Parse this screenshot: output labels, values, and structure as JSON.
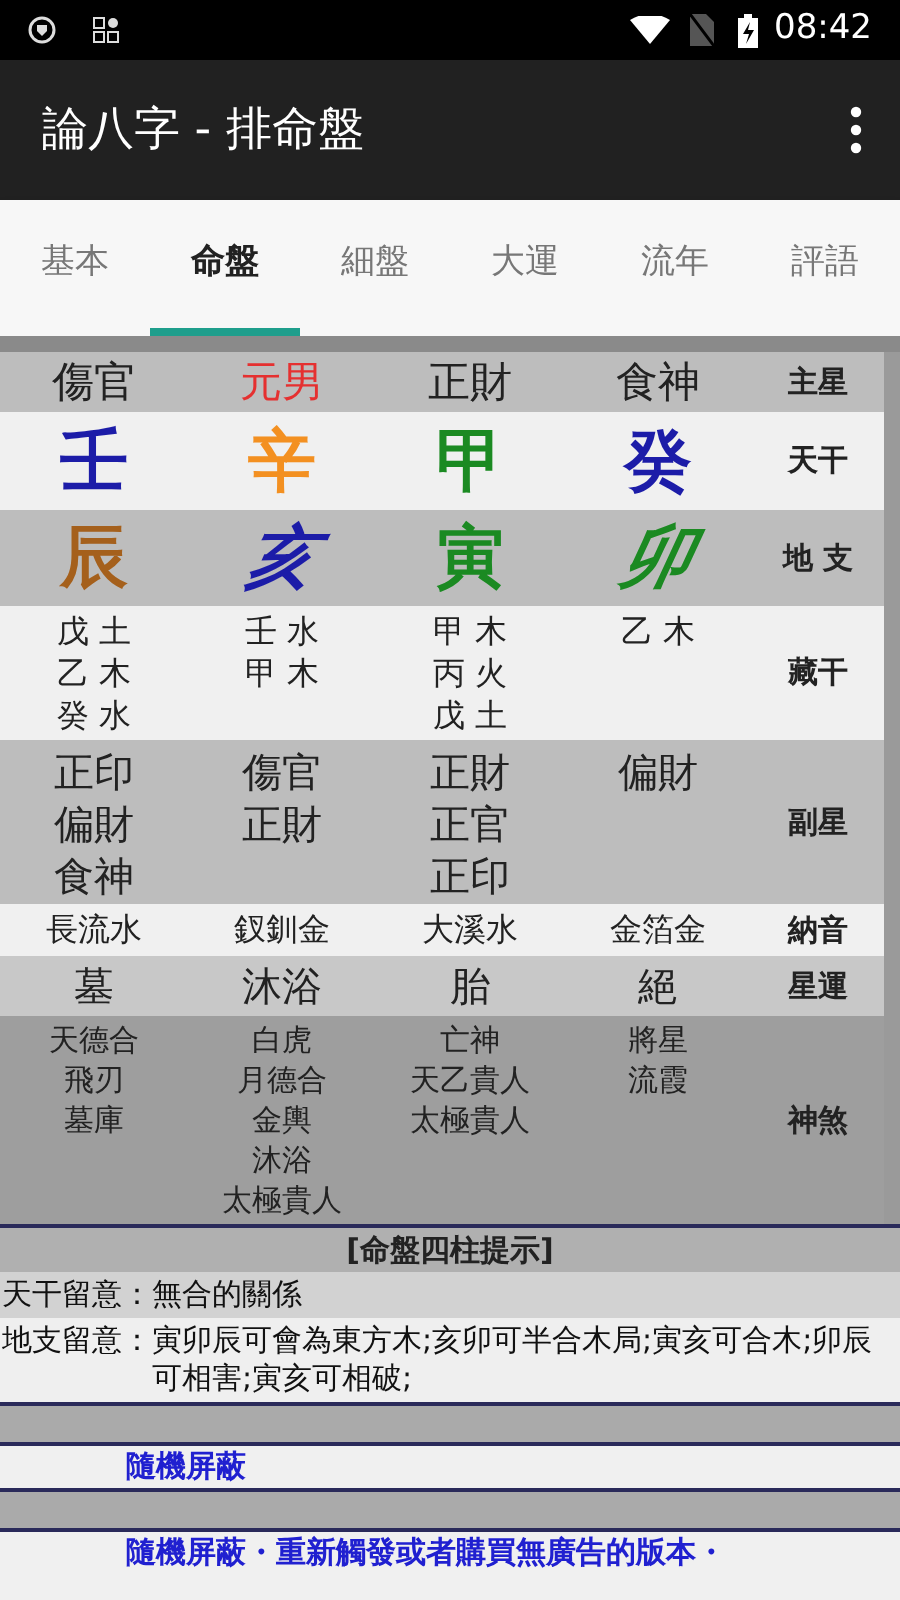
{
  "status_bar": {
    "time": "08:42"
  },
  "app_bar": {
    "title": "論八字 - 排命盤"
  },
  "tabs": [
    {
      "label": "基本",
      "selected": false
    },
    {
      "label": "命盤",
      "selected": true
    },
    {
      "label": "細盤",
      "selected": false
    },
    {
      "label": "大運",
      "selected": false
    },
    {
      "label": "流年",
      "selected": false
    },
    {
      "label": "評語",
      "selected": false
    }
  ],
  "chart_rows": [
    {
      "kind": "main",
      "label": "主星",
      "cells": [
        {
          "text": "傷官",
          "color": "#222222"
        },
        {
          "text": "元男",
          "color": "#e53030"
        },
        {
          "text": "正財",
          "color": "#222222"
        },
        {
          "text": "食神",
          "color": "#222222"
        }
      ]
    },
    {
      "kind": "stem",
      "label": "天干",
      "cells": [
        {
          "text": "壬",
          "color": "#1c1ca8"
        },
        {
          "text": "辛",
          "color": "#f39021"
        },
        {
          "text": "甲",
          "color": "#1b8a22"
        },
        {
          "text": "癸",
          "color": "#1c1ca8"
        }
      ]
    },
    {
      "kind": "branch",
      "label": "地 支",
      "cells": [
        {
          "text": "辰",
          "color": "#a5601c",
          "italic": false
        },
        {
          "text": "亥",
          "color": "#1c1ca8",
          "italic": true
        },
        {
          "text": "寅",
          "color": "#1b8a22",
          "italic": false
        },
        {
          "text": "卯",
          "color": "#1b8a22",
          "italic": true
        }
      ]
    },
    {
      "kind": "hidden",
      "label": "藏干",
      "cells": [
        [
          "戊 土",
          "乙 木",
          "癸 水"
        ],
        [
          "壬 水",
          "甲 木"
        ],
        [
          "甲 木",
          "丙 火",
          "戊 土"
        ],
        [
          "乙 木"
        ]
      ]
    },
    {
      "kind": "sub",
      "label": "副星",
      "cells": [
        [
          "正印",
          "偏財",
          "食神"
        ],
        [
          "傷官",
          "正財"
        ],
        [
          "正財",
          "正官",
          "正印"
        ],
        [
          "偏財"
        ]
      ]
    },
    {
      "kind": "nayin",
      "label": "納音",
      "cells": [
        "長流水",
        "釵釧金",
        "大溪水",
        "金箔金"
      ]
    },
    {
      "kind": "luck",
      "label": "星運",
      "cells": [
        "墓",
        "沐浴",
        "胎",
        "絕"
      ]
    },
    {
      "kind": "shensha",
      "label": "神煞",
      "cells": [
        [
          "天德合",
          "飛刃",
          "墓庫"
        ],
        [
          "白虎",
          "月德合",
          "金輿",
          "沐浴",
          "太極貴人"
        ],
        [
          "亡神",
          "天乙貴人",
          "太極貴人"
        ],
        [
          "將星",
          "流霞"
        ]
      ]
    }
  ],
  "hints": {
    "title": "[命盤四柱提示]",
    "items": [
      {
        "label": "天干留意：",
        "text": "無合的關係"
      },
      {
        "label": "地支留意：",
        "text": "寅卯辰可會為東方木;亥卯可半合木局;寅亥可合木;卯辰可相害;寅亥可相破;"
      }
    ]
  },
  "ad_links": [
    "隨機屏蔽",
    "隨機屏蔽・重新觸發或者購買無廣告的版本・"
  ]
}
